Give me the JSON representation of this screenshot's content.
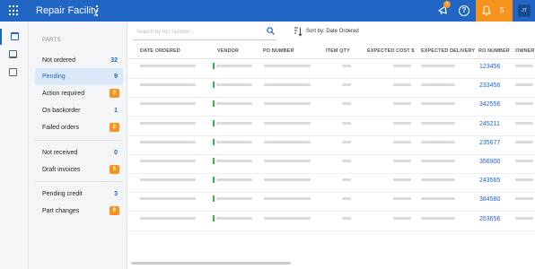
{
  "app": {
    "title": "Repair Facility"
  },
  "header": {
    "announce_badge": "2",
    "help_glyph": "?",
    "notification_count": "5",
    "avatar_initials": "JT"
  },
  "rail": {
    "icons": [
      "table-view-icon",
      "card-view-icon",
      "document-icon"
    ]
  },
  "filters": {
    "heading": "PARTS",
    "items": [
      {
        "label": "Not ordered",
        "count": "32",
        "style": "plain"
      },
      {
        "label": "Pending",
        "count": "9",
        "style": "plain",
        "active": true
      },
      {
        "label": "Action required",
        "count": "3",
        "style": "orange"
      },
      {
        "label": "On backorder",
        "count": "1",
        "style": "plain"
      },
      {
        "label": "Failed orders",
        "count": "2",
        "style": "orange"
      },
      {
        "label": "Not received",
        "count": "0",
        "style": "plain"
      },
      {
        "label": "Draft invoices",
        "count": "5",
        "style": "orange"
      },
      {
        "label": "Pending credit",
        "count": "3",
        "style": "plain"
      },
      {
        "label": "Part changes",
        "count": "9",
        "style": "orange"
      }
    ]
  },
  "search": {
    "placeholder": "Search by RO number..."
  },
  "sort": {
    "label": "Sort by: Date Ordered"
  },
  "table": {
    "columns": [
      "DATE ORDERED",
      "VENDOR",
      "PO NUMBER",
      "ITEM QTY",
      "EXPECTED COST $",
      "EXPECTED DELIVERY",
      "RO NUMBER",
      "OWNER"
    ],
    "ro_numbers": [
      "123456",
      "233456",
      "342556",
      "245211",
      "235677",
      "356900",
      "243565",
      "384580",
      "253656"
    ]
  },
  "colors": {
    "primary": "#2166c4",
    "accent": "#f7941d",
    "vendor_status": "#38b24a",
    "placeholder_bar": "#d7dadf"
  }
}
